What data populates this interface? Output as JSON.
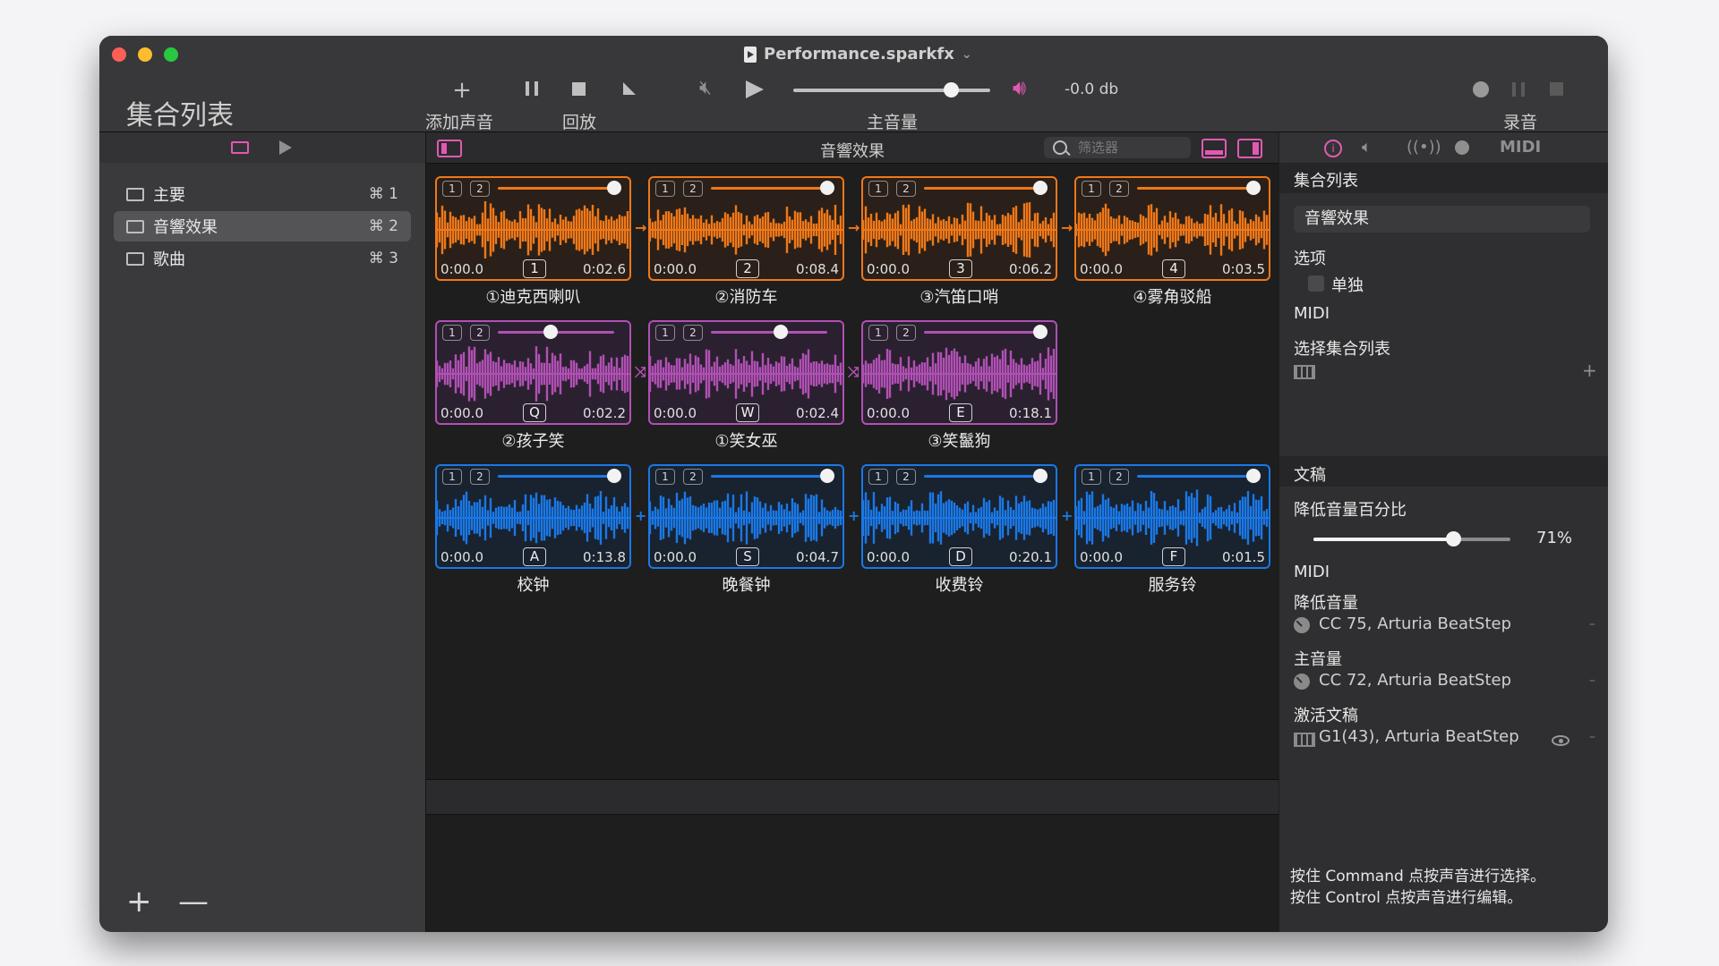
{
  "window": {
    "title": "Performance.sparkfx",
    "title_chevron": "⌄"
  },
  "toolbar": {
    "add_label": "添加声音",
    "playback_label": "回放",
    "master_label": "主音量",
    "master_db": "-0.0 db",
    "master_level": 0.8,
    "record_label": "录音",
    "icons": [
      "plus-icon",
      "pause-icon",
      "stop-icon",
      "play-step-icon",
      "mute-icon",
      "play-icon",
      "speaker-icon"
    ]
  },
  "sidebar": {
    "title": "集合列表",
    "items": [
      {
        "label": "主要",
        "shortcut": "⌘ 1",
        "active": false
      },
      {
        "label": "音響效果",
        "shortcut": "⌘ 2",
        "active": true
      },
      {
        "label": "歌曲",
        "shortcut": "⌘ 3",
        "active": false
      }
    ],
    "add": "+",
    "remove": "—"
  },
  "center": {
    "title": "音響效果",
    "filter_placeholder": "筛选器",
    "colors": {
      "orange": "#f07818",
      "purple": "#b050b4",
      "blue": "#1a78e6"
    },
    "rows": [
      {
        "color": "orange",
        "link": "→",
        "sounds": [
          {
            "label": "①迪克西喇叭",
            "start": "0:00.0",
            "end": "0:02.6",
            "key": "1",
            "level": 1.0
          },
          {
            "label": "②消防车",
            "start": "0:00.0",
            "end": "0:08.4",
            "key": "2",
            "level": 1.0
          },
          {
            "label": "③汽笛口哨",
            "start": "0:00.0",
            "end": "0:06.2",
            "key": "3",
            "level": 1.0
          },
          {
            "label": "④雾角驳船",
            "start": "0:00.0",
            "end": "0:03.5",
            "key": "4",
            "level": 1.0
          }
        ]
      },
      {
        "color": "purple",
        "link": "⤨",
        "sounds": [
          {
            "label": "②孩子笑",
            "start": "0:00.0",
            "end": "0:02.2",
            "key": "Q",
            "level": 0.45
          },
          {
            "label": "①笑女巫",
            "start": "0:00.0",
            "end": "0:02.4",
            "key": "W",
            "level": 0.6
          },
          {
            "label": "③笑鬣狗",
            "start": "0:00.0",
            "end": "0:18.1",
            "key": "E",
            "level": 1.0
          }
        ]
      },
      {
        "color": "blue",
        "link": "+",
        "sounds": [
          {
            "label": "校钟",
            "start": "0:00.0",
            "end": "0:13.8",
            "key": "A",
            "level": 1.0
          },
          {
            "label": "晚餐钟",
            "start": "0:00.0",
            "end": "0:04.7",
            "key": "S",
            "level": 1.0
          },
          {
            "label": "收费铃",
            "start": "0:00.0",
            "end": "0:20.1",
            "key": "D",
            "level": 1.0
          },
          {
            "label": "服务铃",
            "start": "0:00.0",
            "end": "0:01.5",
            "key": "F",
            "level": 1.0
          }
        ]
      }
    ]
  },
  "inspector": {
    "tab_midi": "MIDI",
    "setlist_section": "集合列表",
    "setlist_name": "音響效果",
    "options_label": "选项",
    "solo_label": "单独",
    "midi_label": "MIDI",
    "select_setlist_label": "选择集合列表",
    "add": "+",
    "cue_section": "文稿",
    "dim_label": "降低音量百分比",
    "dim_value": "71%",
    "dim_level": 0.71,
    "midi_label_2": "MIDI",
    "dim_volume_label": "降低音量",
    "dim_volume_value": "CC 75, Arturia BeatStep",
    "master_volume_label": "主音量",
    "master_volume_value": "CC 72, Arturia BeatStep",
    "activate_cue_label": "激活文稿",
    "activate_cue_value": "G1(43), Arturia BeatStep",
    "dash": "–",
    "hint_1": "按住 Command 点按声音进行选择。",
    "hint_2": "按住 Control 点按声音进行编辑。"
  }
}
